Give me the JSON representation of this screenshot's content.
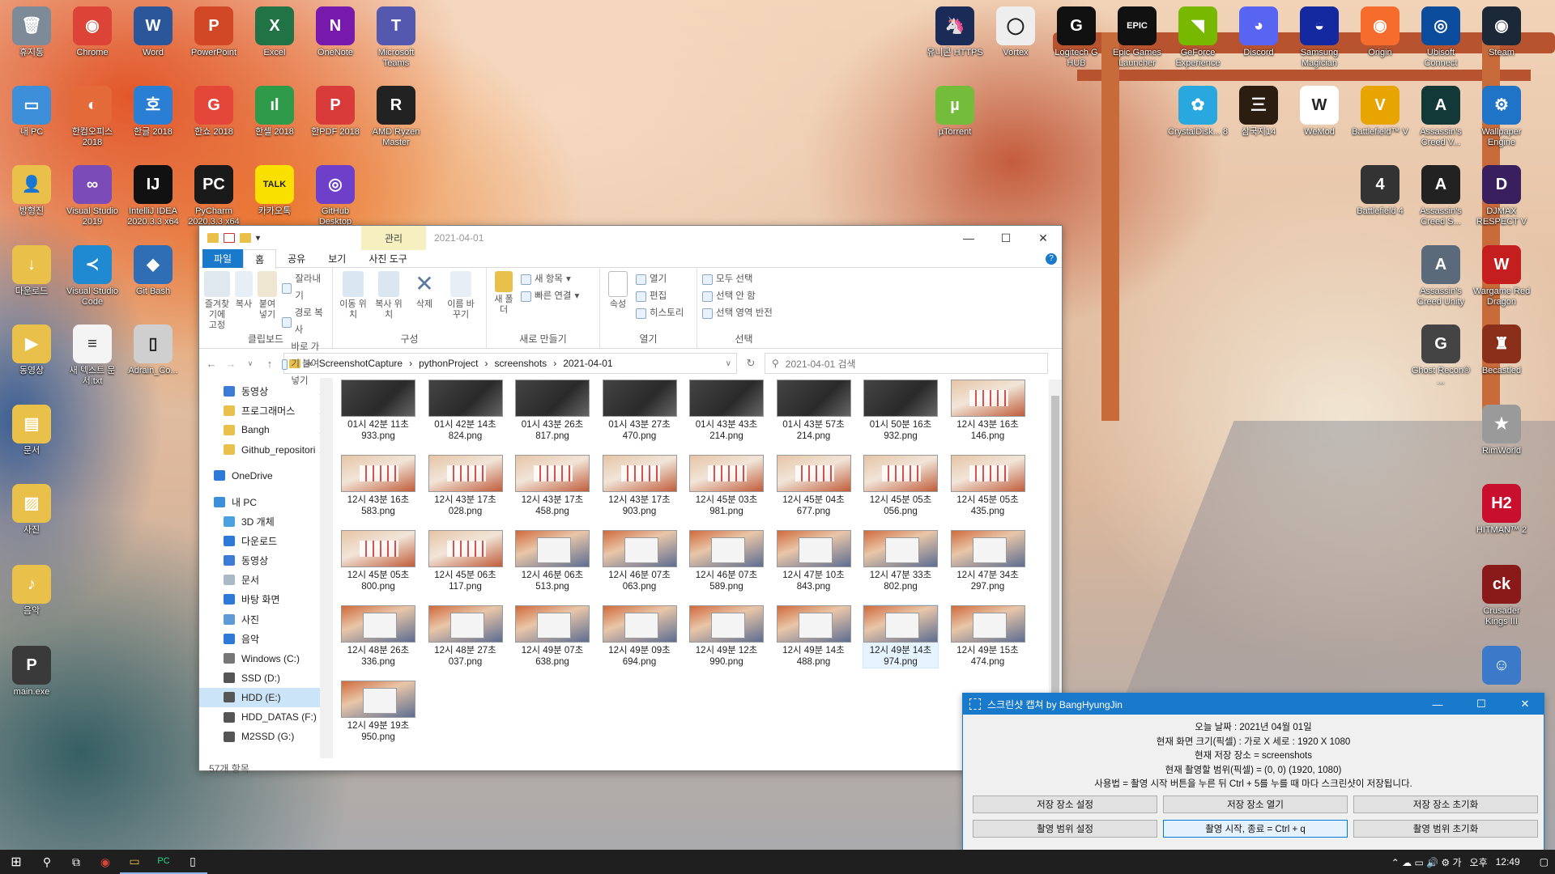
{
  "desktop_icons": [
    {
      "label": "휴지통",
      "color": "#7d8a97",
      "glyph": "🗑",
      "icon": "recycle-bin-icon"
    },
    {
      "label": "Chrome",
      "color": "#db4437",
      "glyph": "◉",
      "icon": "chrome-icon"
    },
    {
      "label": "Word",
      "color": "#2b579a",
      "glyph": "W",
      "icon": "word-icon"
    },
    {
      "label": "PowerPoint",
      "color": "#d24726",
      "glyph": "P",
      "icon": "powerpoint-icon"
    },
    {
      "label": "Excel",
      "color": "#217346",
      "glyph": "X",
      "icon": "excel-icon"
    },
    {
      "label": "OneNote",
      "color": "#7719aa",
      "glyph": "N",
      "icon": "onenote-icon"
    },
    {
      "label": "Microsoft Teams",
      "color": "#5558af",
      "glyph": "T",
      "icon": "teams-icon"
    },
    {
      "label": "내 PC",
      "color": "#3c8fd8",
      "glyph": "▭",
      "icon": "my-pc-icon"
    },
    {
      "label": "한컴오피스 2018",
      "color": "#e46a3a",
      "glyph": "◐",
      "icon": "hancom-office-icon"
    },
    {
      "label": "한글 2018",
      "color": "#2a7fd4",
      "glyph": "호",
      "icon": "hangul-icon"
    },
    {
      "label": "한쇼 2018",
      "color": "#e4463a",
      "glyph": "G",
      "icon": "hanshow-icon"
    },
    {
      "label": "한셀 2018",
      "color": "#2e9b4b",
      "glyph": "ıl",
      "icon": "hancell-icon"
    },
    {
      "label": "한PDF 2018",
      "color": "#d93a3a",
      "glyph": "P",
      "icon": "hanpdf-icon"
    },
    {
      "label": "AMD Ryzen Master",
      "color": "#222",
      "glyph": "R",
      "icon": "amd-ryzen-icon"
    },
    {
      "label": "방형진",
      "color": "#e8c04a",
      "glyph": "👤",
      "icon": "user-folder-icon"
    },
    {
      "label": "Visual Studio 2019",
      "color": "#7b4bb8",
      "glyph": "∞",
      "icon": "visual-studio-icon"
    },
    {
      "label": "IntelliJ IDEA 2020.3.3 x64",
      "color": "#111",
      "glyph": "IJ",
      "icon": "intellij-icon"
    },
    {
      "label": "PyCharm 2020.3.3 x64",
      "color": "#1a1a1a",
      "glyph": "PC",
      "icon": "pycharm-icon"
    },
    {
      "label": "카카오톡",
      "color": "#f9e000",
      "glyph": "TALK",
      "icon": "kakaotalk-icon"
    },
    {
      "label": "GitHub Desktop",
      "color": "#6e40c9",
      "glyph": "◎",
      "icon": "github-desktop-icon"
    },
    {
      "label": "다운로드",
      "color": "#e8c04a",
      "glyph": "↓",
      "icon": "downloads-folder-icon"
    },
    {
      "label": "Visual Studio Code",
      "color": "#1f8ad2",
      "glyph": "≺",
      "icon": "vscode-icon"
    },
    {
      "label": "Git Bash",
      "color": "#2f6db5",
      "glyph": "◆",
      "icon": "git-bash-icon"
    },
    {
      "label": "동영상",
      "color": "#e8c04a",
      "glyph": "▶",
      "icon": "videos-folder-icon"
    },
    {
      "label": "새 텍스트 문서.txt",
      "color": "#f4f4f4",
      "glyph": "≡",
      "icon": "text-file-icon"
    },
    {
      "label": "Adrain_Co...",
      "color": "#cfcfcf",
      "glyph": "▯",
      "icon": "file-icon"
    },
    {
      "label": "문서",
      "color": "#e8c04a",
      "glyph": "▤",
      "icon": "documents-folder-icon"
    },
    {
      "label": "사진",
      "color": "#e8c04a",
      "glyph": "▨",
      "icon": "pictures-folder-icon"
    },
    {
      "label": "음악",
      "color": "#e8c04a",
      "glyph": "♪",
      "icon": "music-folder-icon"
    },
    {
      "label": "main.exe",
      "color": "#3a3a3a",
      "glyph": "P",
      "icon": "exe-icon"
    },
    {
      "label": "유니콘 HTTPS",
      "color": "#1a2b58",
      "glyph": "🦄",
      "icon": "unicorn-https-icon"
    },
    {
      "label": "Vortex",
      "color": "#eeeeee",
      "glyph": "◯",
      "icon": "vortex-icon"
    },
    {
      "label": "Logitech G HUB",
      "color": "#111",
      "glyph": "G",
      "icon": "logitech-ghub-icon"
    },
    {
      "label": "Epic Games Launcher",
      "color": "#111",
      "glyph": "EPIC",
      "icon": "epic-games-icon"
    },
    {
      "label": "GeForce Experience",
      "color": "#76b900",
      "glyph": "◥",
      "icon": "geforce-icon"
    },
    {
      "label": "Discord",
      "color": "#5865f2",
      "glyph": "◕",
      "icon": "discord-icon"
    },
    {
      "label": "Samsung Magician",
      "color": "#1428a0",
      "glyph": "◒",
      "icon": "samsung-magician-icon"
    },
    {
      "label": "Origin",
      "color": "#f56c2d",
      "glyph": "◉",
      "icon": "origin-icon"
    },
    {
      "label": "Ubisoft Connect",
      "color": "#0c4c9d",
      "glyph": "◎",
      "icon": "ubisoft-icon"
    },
    {
      "label": "Steam",
      "color": "#1b2838",
      "glyph": "◉",
      "icon": "steam-icon"
    },
    {
      "label": "µTorrent",
      "color": "#74bd3a",
      "glyph": "µ",
      "icon": "utorrent-icon"
    },
    {
      "label": "CrystalDisk... 8",
      "color": "#29a8e0",
      "glyph": "✿",
      "icon": "crystaldisk-icon"
    },
    {
      "label": "삼국지14",
      "color": "#2b1d10",
      "glyph": "三",
      "icon": "sangokushi-icon"
    },
    {
      "label": "WeMod",
      "color": "#fff",
      "glyph": "W",
      "icon": "wemod-icon"
    },
    {
      "label": "Battlefield™ V",
      "color": "#e8a400",
      "glyph": "V",
      "icon": "battlefield-v-icon"
    },
    {
      "label": "Assassin's Creed V...",
      "color": "#123838",
      "glyph": "A",
      "icon": "ac-valhalla-icon"
    },
    {
      "label": "Wallpaper Engine",
      "color": "#1f74c8",
      "glyph": "⚙",
      "icon": "wallpaper-engine-icon"
    },
    {
      "label": "Battlefield 4",
      "color": "#333",
      "glyph": "4",
      "icon": "battlefield-4-icon"
    },
    {
      "label": "Assassin's Creed S...",
      "color": "#222",
      "glyph": "A",
      "icon": "ac-syndicate-icon"
    },
    {
      "label": "DJMAX RESPECT V",
      "color": "#3a1f5f",
      "glyph": "D",
      "icon": "djmax-icon"
    },
    {
      "label": "Assassin's Creed Unity",
      "color": "#5a6a7a",
      "glyph": "A",
      "icon": "ac-unity-icon"
    },
    {
      "label": "Wargame Red Dragon",
      "color": "#c41e1e",
      "glyph": "W",
      "icon": "wargame-icon"
    },
    {
      "label": "Ghost Recon® ...",
      "color": "#444",
      "glyph": "G",
      "icon": "ghost-recon-icon"
    },
    {
      "label": "Becastled",
      "color": "#8a2f1a",
      "glyph": "♜",
      "icon": "becastled-icon"
    },
    {
      "label": "RimWorld",
      "color": "#9a9a9a",
      "glyph": "★",
      "icon": "rimworld-icon"
    },
    {
      "label": "HITMAN™ 2",
      "color": "#c8102e",
      "glyph": "H2",
      "icon": "hitman-icon"
    },
    {
      "label": "Crusader Kings III",
      "color": "#8a1a1a",
      "glyph": "ck",
      "icon": "crusader-kings-icon"
    },
    {
      "label": "",
      "color": "#3a7ac8",
      "glyph": "☺",
      "icon": "fallout-icon"
    }
  ],
  "explorer": {
    "title": "2021-04-01",
    "context_tab": "관리",
    "tabs": [
      "파일",
      "홈",
      "공유",
      "보기",
      "사진 도구"
    ],
    "window_buttons": {
      "min": "—",
      "max": "☐",
      "close": "✕"
    },
    "help": "?",
    "ribbon": {
      "clipboard": {
        "label": "클립보드",
        "pin": "즐겨찾기에 고정",
        "copy": "복사",
        "paste": "붙여넣기",
        "cut": "잘라내기",
        "copy_path": "경로 복사",
        "paste_shortcut": "바로 가기 붙여넣기"
      },
      "organize": {
        "label": "구성",
        "move": "이동 위치",
        "copyto": "복사 위치",
        "delete": "삭제",
        "rename": "이름 바꾸기"
      },
      "new": {
        "label": "새로 만들기",
        "folder": "새 폴더",
        "item": "새 항목",
        "easy_access": "빠른 연결"
      },
      "open": {
        "label": "열기",
        "properties": "속성",
        "open": "열기",
        "edit": "편집",
        "history": "히스토리"
      },
      "select": {
        "label": "선택",
        "all": "모두 선택",
        "none": "선택 안 함",
        "invert": "선택 영역 반전"
      }
    },
    "address": {
      "prefix": "«",
      "parts": [
        "ScreenshotCapture",
        "pythonProject",
        "screenshots",
        "2021-04-01"
      ],
      "sep": "›"
    },
    "search_placeholder": "2021-04-01 검색",
    "nav_items": [
      {
        "label": "동영상",
        "pinned": true,
        "color": "#3d7bd6",
        "level": 1
      },
      {
        "label": "프로그래머스",
        "pinned": true,
        "color": "#e8c04a",
        "level": 1
      },
      {
        "label": "Bangh",
        "pinned": true,
        "color": "#e8c04a",
        "level": 1
      },
      {
        "label": "Github_repositori",
        "pinned": true,
        "color": "#e8c04a",
        "level": 1
      },
      {
        "label": "OneDrive",
        "pinned": false,
        "color": "#2d7ad6",
        "level": 0
      },
      {
        "label": "내 PC",
        "pinned": false,
        "color": "#3c8fd8",
        "level": 0
      },
      {
        "label": "3D 개체",
        "pinned": false,
        "color": "#4aa3e0",
        "level": 1
      },
      {
        "label": "다운로드",
        "pinned": false,
        "color": "#2d7ad6",
        "level": 1
      },
      {
        "label": "동영상",
        "pinned": false,
        "color": "#3d7bd6",
        "level": 1
      },
      {
        "label": "문서",
        "pinned": false,
        "color": "#aab8c8",
        "level": 1
      },
      {
        "label": "바탕 화면",
        "pinned": false,
        "color": "#2d7ad6",
        "level": 1
      },
      {
        "label": "사진",
        "pinned": false,
        "color": "#5c9ad8",
        "level": 1
      },
      {
        "label": "음악",
        "pinned": false,
        "color": "#2d7ad6",
        "level": 1
      },
      {
        "label": "Windows (C:)",
        "pinned": false,
        "color": "#777",
        "level": 1
      },
      {
        "label": "SSD (D:)",
        "pinned": false,
        "color": "#555",
        "level": 1
      },
      {
        "label": "HDD (E:)",
        "pinned": false,
        "color": "#555",
        "level": 1,
        "selected": true
      },
      {
        "label": "HDD_DATAS (F:)",
        "pinned": false,
        "color": "#555",
        "level": 1
      },
      {
        "label": "M2SSD (G:)",
        "pinned": false,
        "color": "#555",
        "level": 1
      }
    ],
    "files": [
      {
        "n1": "01시 42분 11초",
        "n2": "933.png",
        "t": 1
      },
      {
        "n1": "01시 42분 14초",
        "n2": "824.png",
        "t": 1
      },
      {
        "n1": "01시 43분 26초",
        "n2": "817.png",
        "t": 1
      },
      {
        "n1": "01시 43분 27초",
        "n2": "470.png",
        "t": 1
      },
      {
        "n1": "01시 43분 43초",
        "n2": "214.png",
        "t": 1
      },
      {
        "n1": "01시 43분 57초",
        "n2": "214.png",
        "t": 1
      },
      {
        "n1": "01시 50분 16초",
        "n2": "932.png",
        "t": 1
      },
      {
        "n1": "12시 43분 16초",
        "n2": "146.png",
        "t": 2
      },
      {
        "n1": "12시 43분 16초",
        "n2": "583.png",
        "t": 2
      },
      {
        "n1": "12시 43분 17초",
        "n2": "028.png",
        "t": 2
      },
      {
        "n1": "12시 43분 17초",
        "n2": "458.png",
        "t": 2
      },
      {
        "n1": "12시 43분 17초",
        "n2": "903.png",
        "t": 2
      },
      {
        "n1": "12시 45분 03초",
        "n2": "981.png",
        "t": 2
      },
      {
        "n1": "12시 45분 04초",
        "n2": "677.png",
        "t": 2
      },
      {
        "n1": "12시 45분 05초",
        "n2": "056.png",
        "t": 2
      },
      {
        "n1": "12시 45분 05초",
        "n2": "435.png",
        "t": 2
      },
      {
        "n1": "12시 45분 05초",
        "n2": "800.png",
        "t": 2
      },
      {
        "n1": "12시 45분 06초",
        "n2": "117.png",
        "t": 2
      },
      {
        "n1": "12시 46분 06초",
        "n2": "513.png",
        "t": 3
      },
      {
        "n1": "12시 46분 07초",
        "n2": "063.png",
        "t": 3
      },
      {
        "n1": "12시 46분 07초",
        "n2": "589.png",
        "t": 3
      },
      {
        "n1": "12시 47분 10초",
        "n2": "843.png",
        "t": 3
      },
      {
        "n1": "12시 47분 33초",
        "n2": "802.png",
        "t": 3
      },
      {
        "n1": "12시 47분 34초",
        "n2": "297.png",
        "t": 3
      },
      {
        "n1": "12시 48분 26초",
        "n2": "336.png",
        "t": 3
      },
      {
        "n1": "12시 48분 27초",
        "n2": "037.png",
        "t": 3
      },
      {
        "n1": "12시 49분 07초",
        "n2": "638.png",
        "t": 3
      },
      {
        "n1": "12시 49분 09초",
        "n2": "694.png",
        "t": 3
      },
      {
        "n1": "12시 49분 12초",
        "n2": "990.png",
        "t": 3
      },
      {
        "n1": "12시 49분 14초",
        "n2": "488.png",
        "t": 3
      },
      {
        "n1": "12시 49분 14초",
        "n2": "974.png",
        "t": 3,
        "selected": true
      },
      {
        "n1": "12시 49분 15초",
        "n2": "474.png",
        "t": 3
      },
      {
        "n1": "12시 49분 19초",
        "n2": "950.png",
        "t": 3
      }
    ],
    "status": "57개 항목"
  },
  "capture_app": {
    "title": "스크린샷 캡쳐 by BangHyungJin",
    "window_buttons": {
      "min": "—",
      "max": "☐",
      "close": "✕"
    },
    "lines": [
      "오늘 날짜 : 2021년 04월 01일",
      "현재 화면 크기(픽셀) : 가로 X 세로 : 1920 X 1080",
      "현재 저장 장소 = screenshots",
      "현재 촬영할 범위(픽셀) = (0, 0) (1920, 1080)",
      "사용법 = 촬영 시작 버튼을 누른 뒤 Ctrl + 5를 누를 때 마다 스크린샷이 저장됩니다."
    ],
    "buttons": [
      "저장 장소 설정",
      "저장 장소 열기",
      "저장 장소 초기화",
      "촬영 범위 설정",
      "촬영 시작, 종료 = Ctrl + q",
      "촬영 범위 초기화"
    ]
  },
  "taskbar": {
    "start": "⊞",
    "search": "⚲",
    "taskview": "⧉",
    "apps": [
      {
        "glyph": "◉",
        "icon": "chrome-taskbar-icon",
        "color": "#db4437"
      },
      {
        "glyph": "▭",
        "icon": "explorer-taskbar-icon",
        "color": "#e8c04a"
      },
      {
        "glyph": "PC",
        "icon": "pycharm-taskbar-icon",
        "color": "#21d789"
      },
      {
        "glyph": "▯",
        "icon": "capture-app-taskbar-icon",
        "color": "#fff"
      }
    ],
    "tray_glyphs": "⌃ ☁ ▭ 🔊 ⚙ 가",
    "ampm": "오후",
    "time": "12:49",
    "notify": "▢"
  }
}
